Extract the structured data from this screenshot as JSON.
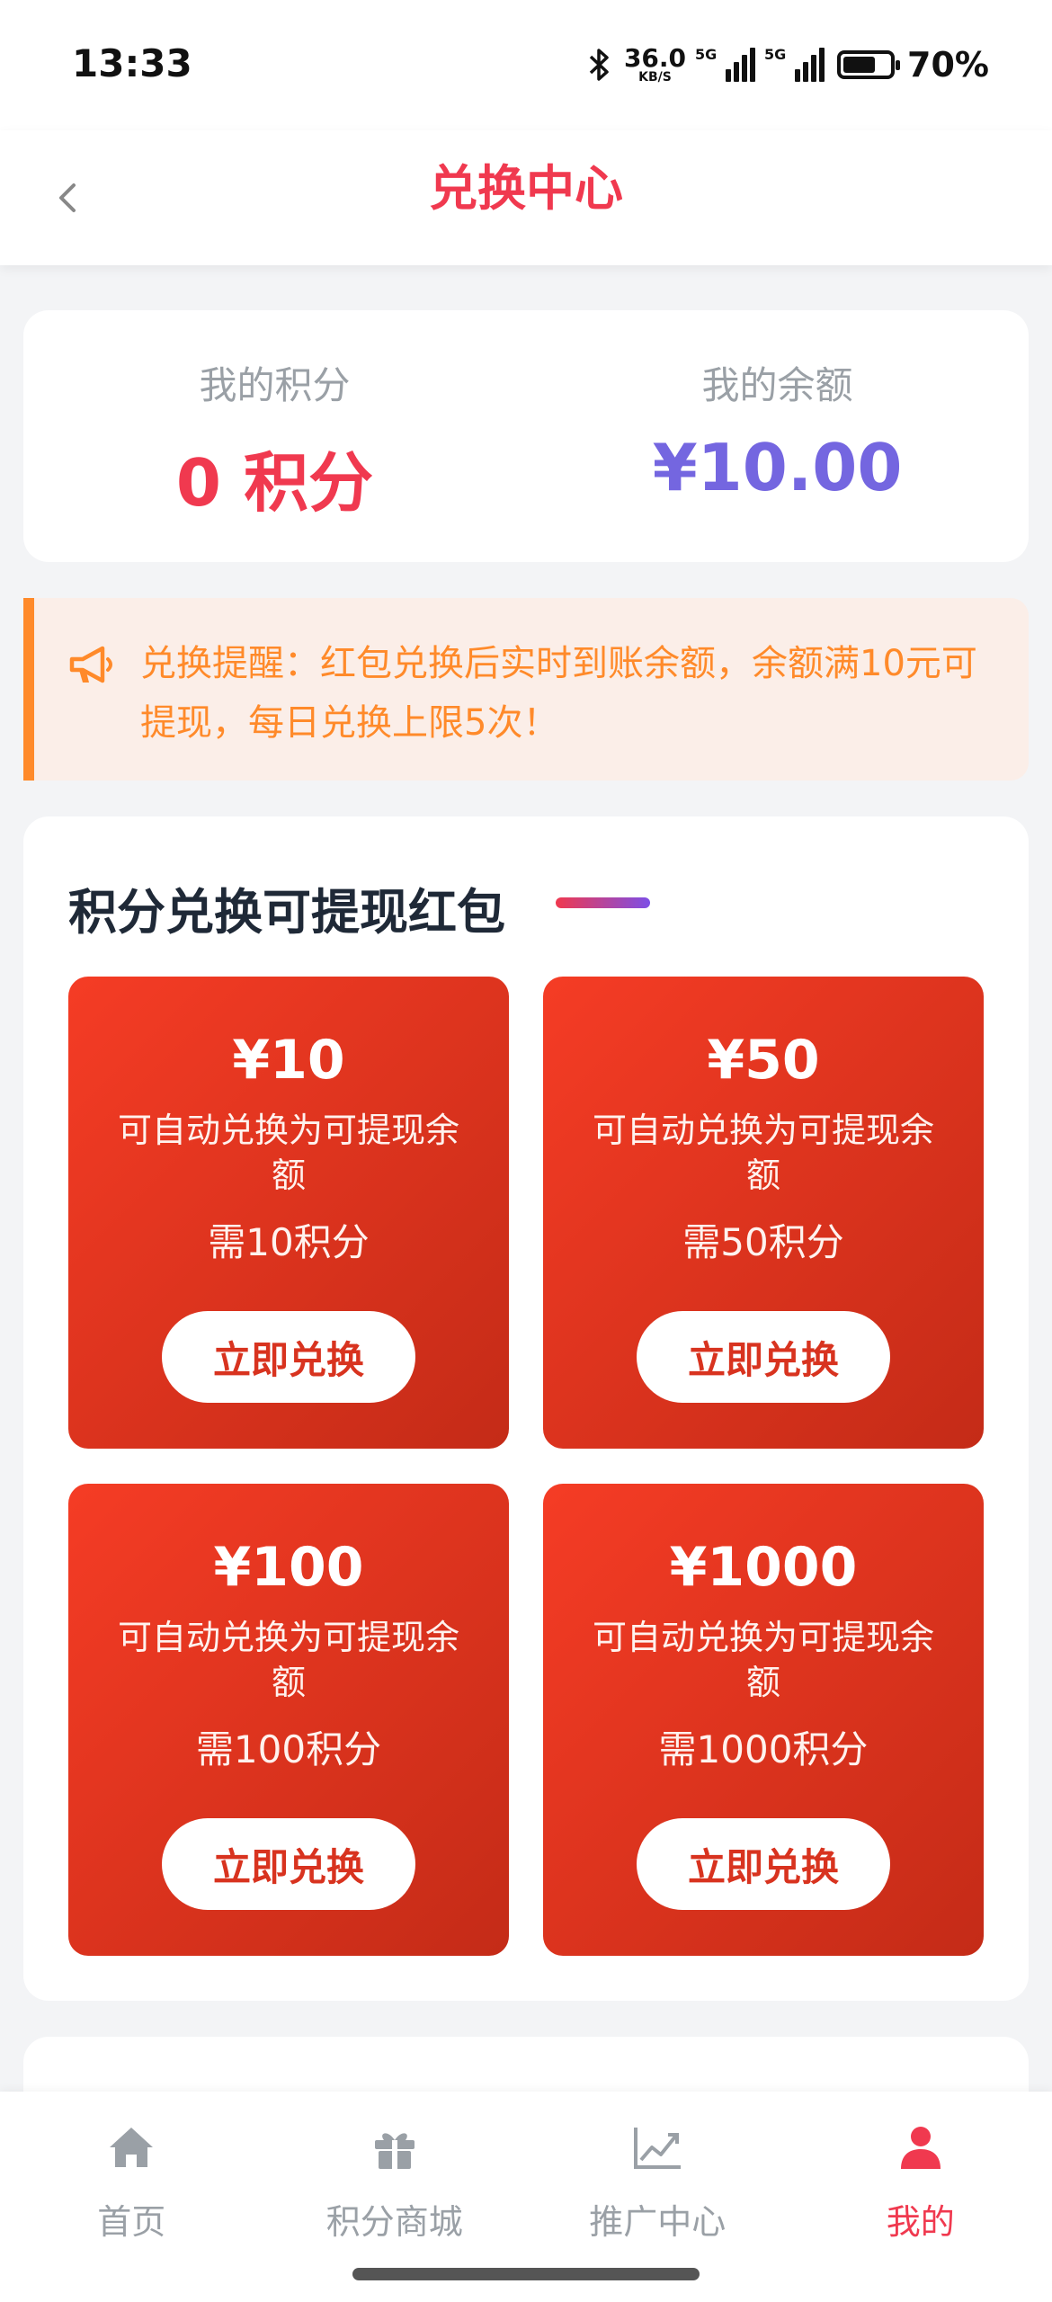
{
  "status_bar": {
    "time": "13:33",
    "net_speed_value": "36.0",
    "net_speed_unit": "KB/S",
    "signal1_tag": "5G",
    "signal2_tag": "5G",
    "battery": "70%",
    "battery_level": 0.7
  },
  "header": {
    "title": "兑换中心"
  },
  "account": {
    "points_label": "我的积分",
    "points_value": "0 积分",
    "balance_label": "我的余额",
    "balance_value": "¥10.00"
  },
  "notice": {
    "text": "兑换提醒：红包兑换后实时到账余额，余额满10元可提现，每日兑换上限5次！"
  },
  "exchange": {
    "title": "积分兑换可提现红包",
    "items": [
      {
        "amount": "¥10",
        "desc": "可自动兑换为可提现余额",
        "cost": "需10积分",
        "button": "立即兑换"
      },
      {
        "amount": "¥50",
        "desc": "可自动兑换为可提现余额",
        "cost": "需50积分",
        "button": "立即兑换"
      },
      {
        "amount": "¥100",
        "desc": "可自动兑换为可提现余额",
        "cost": "需100积分",
        "button": "立即兑换"
      },
      {
        "amount": "¥1000",
        "desc": "可自动兑换为可提现余额",
        "cost": "需1000积分",
        "button": "立即兑换"
      }
    ]
  },
  "bottom_nav": {
    "items": [
      {
        "label": "首页",
        "icon": "home-icon"
      },
      {
        "label": "积分商城",
        "icon": "gift-icon"
      },
      {
        "label": "推广中心",
        "icon": "chart-icon"
      },
      {
        "label": "我的",
        "icon": "user-icon"
      }
    ],
    "active_index": 3
  },
  "colors": {
    "accent": "#f0394f",
    "balance": "#7466e0",
    "notice": "#ff8a2a",
    "packet": "#e23620"
  }
}
